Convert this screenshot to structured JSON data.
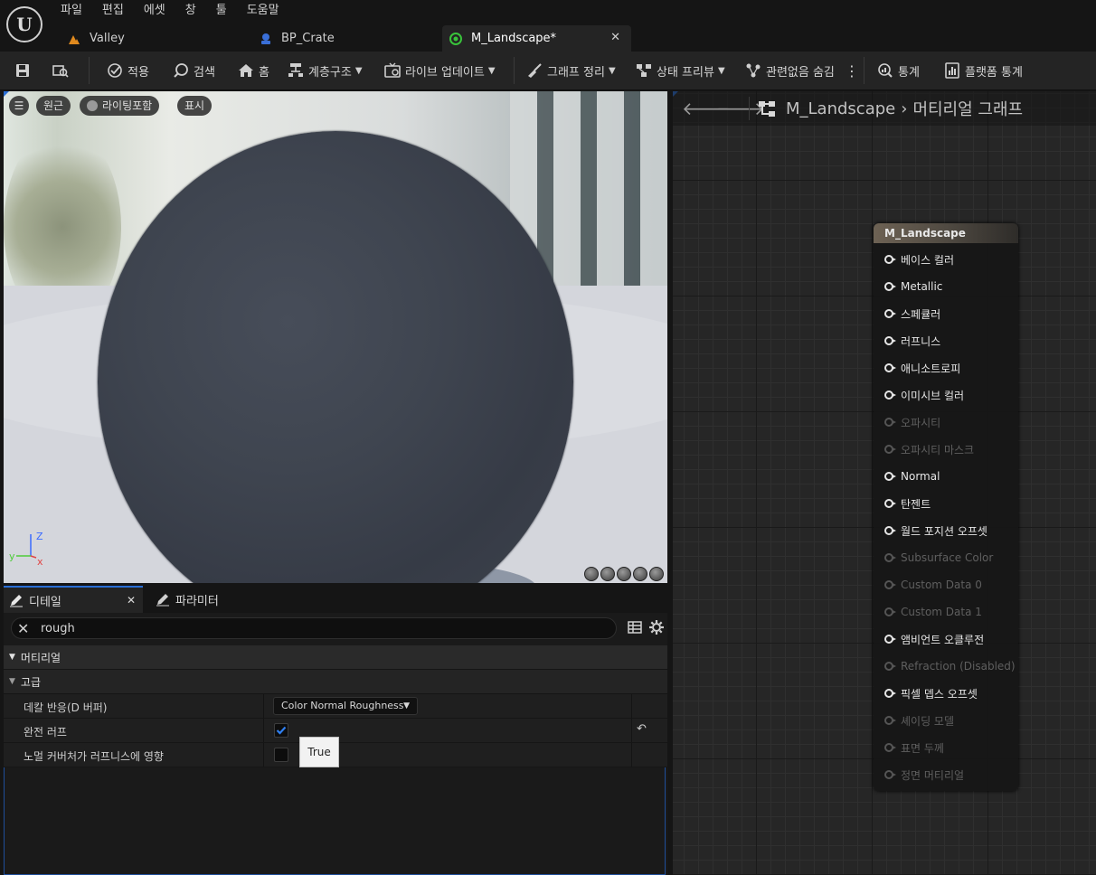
{
  "menu": [
    "파일",
    "편집",
    "에셋",
    "창",
    "툴",
    "도움말"
  ],
  "tabs": [
    {
      "label": "Valley",
      "icon": "level-icon"
    },
    {
      "label": "BP_Crate",
      "icon": "blueprint-icon"
    },
    {
      "label": "M_Landscape*",
      "icon": "material-icon",
      "active": true
    }
  ],
  "toolbar": {
    "apply": "적용",
    "search": "검색",
    "home": "홈",
    "hierarchy": "계층구조",
    "live_update": "라이브 업데이트",
    "graph_cleanup": "그래프 정리",
    "state_preview": "상태 프리뷰",
    "hide_unrelated": "관련없음 숨김",
    "stats": "통계",
    "platform_stats": "플랫폼 통계"
  },
  "viewport": {
    "perspective": "원근",
    "lighting": "라이팅포함",
    "show": "표시",
    "axis_x": "x",
    "axis_y": "y",
    "axis_z": "Z"
  },
  "details": {
    "tab_details": "디테일",
    "tab_params": "파라미터",
    "search_value": "rough",
    "section_material": "머티리얼",
    "section_advanced": "고급",
    "rows": [
      {
        "label": "데칼 반응(D 버퍼)",
        "value": "Color Normal Roughness"
      },
      {
        "label": "완전 러프",
        "checked": true
      },
      {
        "label": "노멀 커버처가 러프니스에 영향",
        "checked": false
      }
    ],
    "tooltip": "True"
  },
  "graph": {
    "breadcrumb_asset": "M_Landscape",
    "breadcrumb_graph": "머티리얼 그래프",
    "node_title": "M_Landscape",
    "pins": [
      {
        "label": "베이스 컬러",
        "enabled": true
      },
      {
        "label": "Metallic",
        "enabled": true
      },
      {
        "label": "스페큘러",
        "enabled": true
      },
      {
        "label": "러프니스",
        "enabled": true
      },
      {
        "label": "애니소트로피",
        "enabled": true
      },
      {
        "label": "이미시브 컬러",
        "enabled": true
      },
      {
        "label": "오파시티",
        "enabled": false
      },
      {
        "label": "오파시티 마스크",
        "enabled": false
      },
      {
        "label": "Normal",
        "enabled": true
      },
      {
        "label": "탄젠트",
        "enabled": true
      },
      {
        "label": "월드 포지션 오프셋",
        "enabled": true
      },
      {
        "label": "Subsurface Color",
        "enabled": false
      },
      {
        "label": "Custom Data 0",
        "enabled": false
      },
      {
        "label": "Custom Data 1",
        "enabled": false
      },
      {
        "label": "앰비언트 오클루전",
        "enabled": true
      },
      {
        "label": "Refraction (Disabled)",
        "enabled": false
      },
      {
        "label": "픽셀 뎁스 오프셋",
        "enabled": true
      },
      {
        "label": "셰이딩 모델",
        "enabled": false
      },
      {
        "label": "표면 두께",
        "enabled": false
      },
      {
        "label": "정면 머티리얼",
        "enabled": false
      }
    ]
  },
  "colors": {
    "accent_blue": "#2a6fd6",
    "check_blue": "#2f7ff0",
    "material_tab_green": "#39c43b",
    "valley_orange": "#e08a1e",
    "blueprint_blue": "#3a6fd8"
  }
}
